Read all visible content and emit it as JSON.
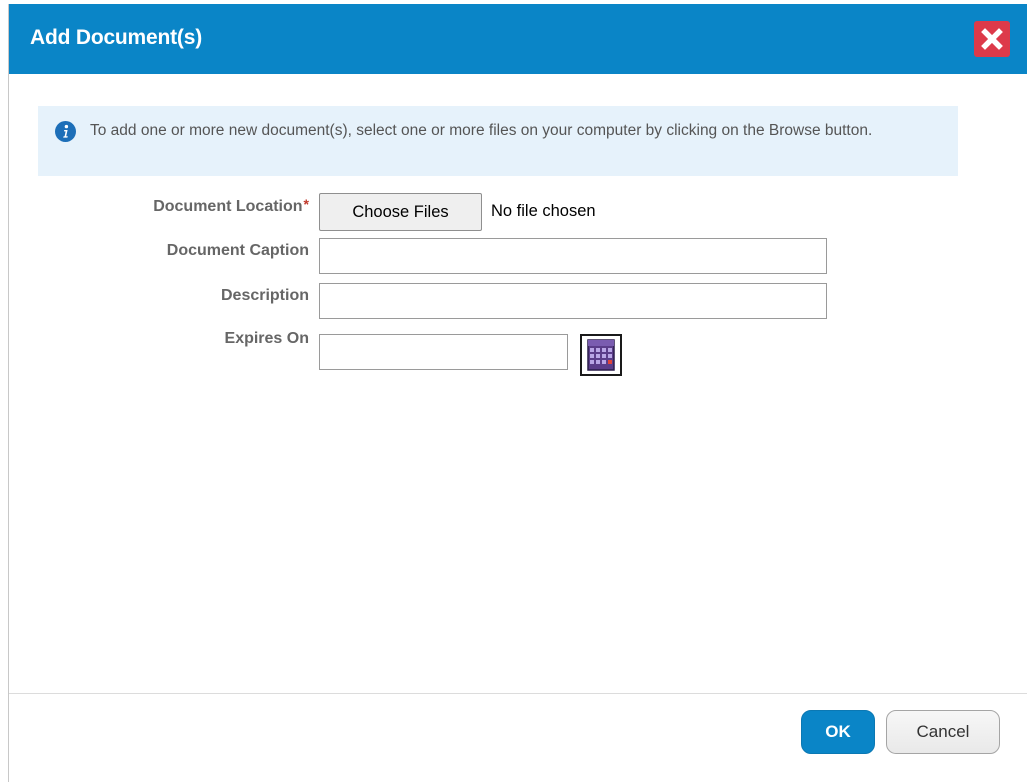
{
  "dialog": {
    "title": "Add Document(s)",
    "close_icon": "close-x-icon",
    "header_color": "#0a85c7",
    "close_color": "#dd3a4a"
  },
  "info": {
    "icon": "info-icon",
    "text": "To add one or more new document(s), select one or more files on your computer by clicking on the Browse button."
  },
  "form": {
    "document_location": {
      "label": "Document Location",
      "required_marker": "*",
      "button_label": "Choose Files",
      "status": "No file chosen"
    },
    "document_caption": {
      "label": "Document Caption",
      "value": ""
    },
    "description": {
      "label": "Description",
      "value": ""
    },
    "expires_on": {
      "label": "Expires On",
      "value": "",
      "calendar_icon": "calendar-icon"
    }
  },
  "footer": {
    "ok_label": "OK",
    "cancel_label": "Cancel"
  }
}
